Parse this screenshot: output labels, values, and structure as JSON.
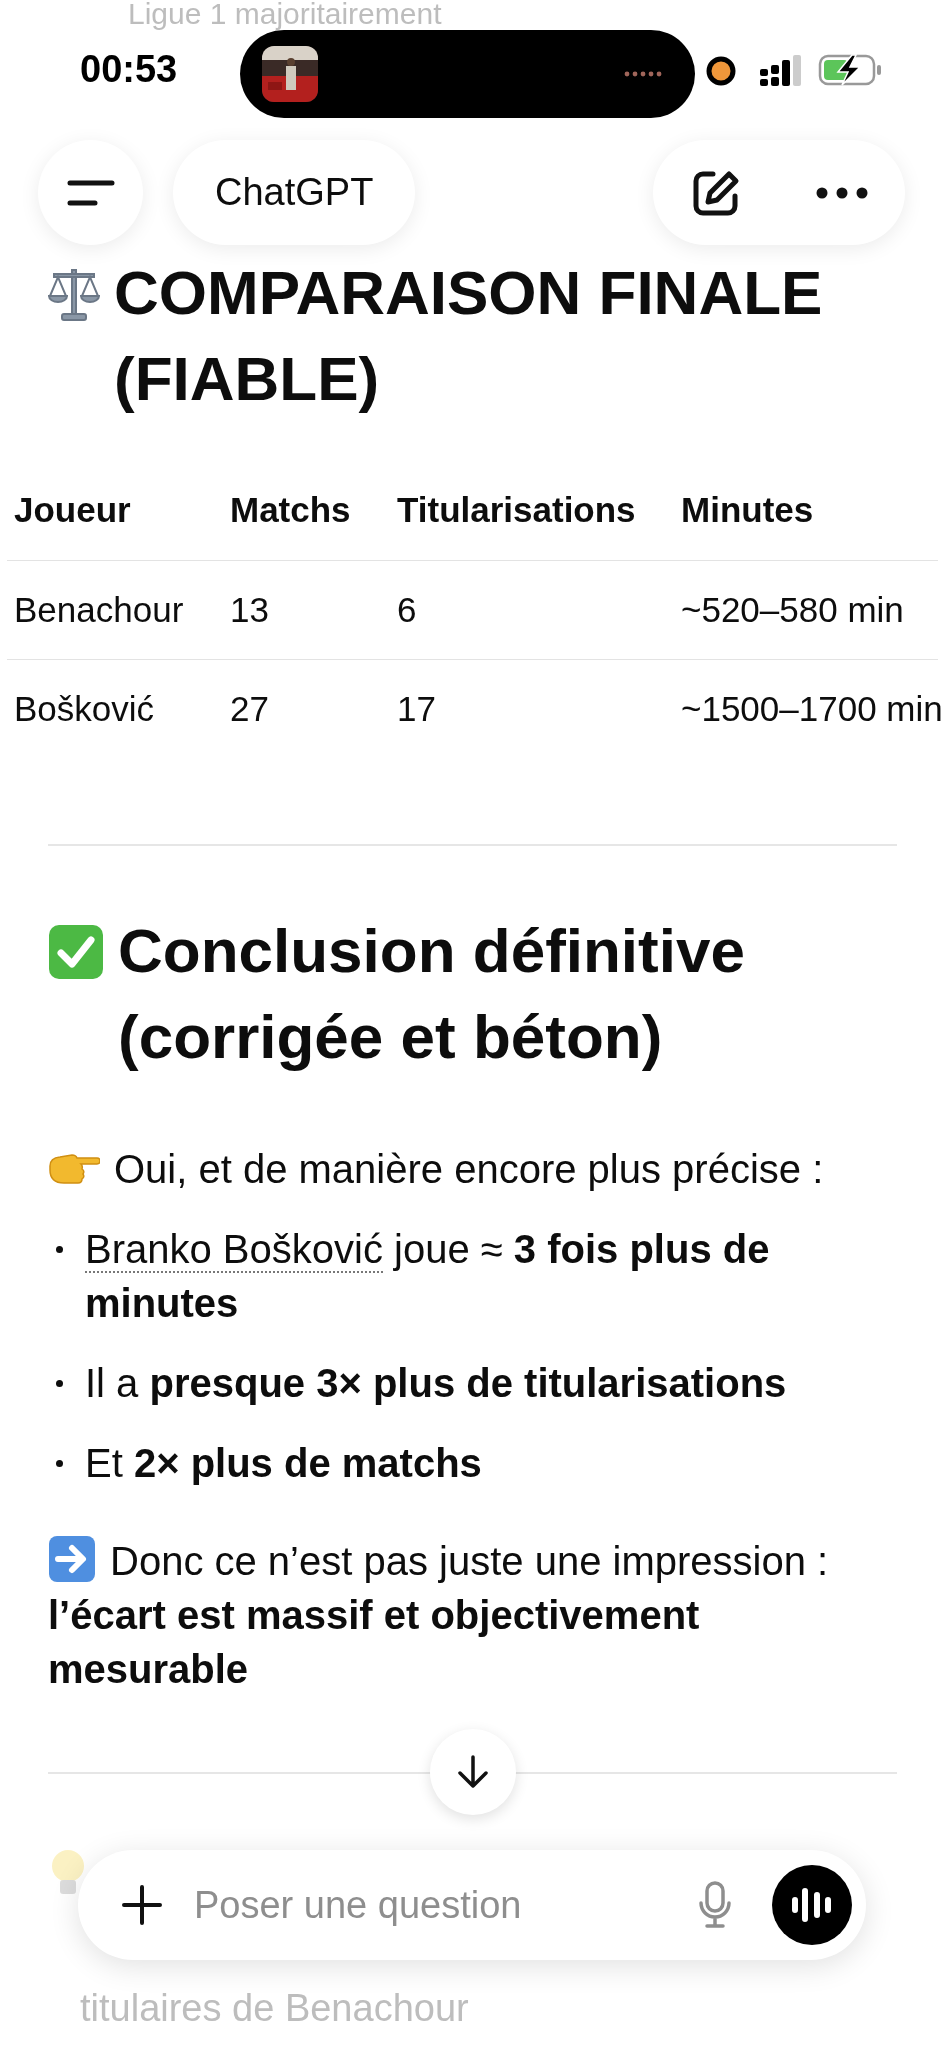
{
  "background_text": {
    "top_line": "Ligue 1 majoritairement",
    "bottom_line": "titulaires de Benachour"
  },
  "status_bar": {
    "time": "00:53"
  },
  "header": {
    "title": "ChatGPT"
  },
  "comparison": {
    "heading": "COMPARAISON FINALE (FIABLE)",
    "table": {
      "columns": [
        "Joueur",
        "Matchs",
        "Titularisations",
        "Minutes"
      ],
      "rows": [
        [
          "Benachour",
          "13",
          "6",
          "~520–580 min"
        ],
        [
          "Bošković",
          "27",
          "17",
          "~1500–1700 min"
        ]
      ]
    }
  },
  "conclusion": {
    "heading": "Conclusion définitive (corrigée et béton)",
    "intro": "Oui, et de manière encore plus précise :",
    "bullets": [
      {
        "link": "Branko Bošković",
        "text": " joue ≈ **3 fois plus de minutes**"
      },
      {
        "text": "Il a **presque 3× plus de titularisations**"
      },
      {
        "text": "Et **2× plus de matchs**"
      }
    ],
    "summary": "Donc ce n’est pas juste une impression : **l’écart est massif et objectivement mesurable**"
  },
  "composer": {
    "placeholder": "Poser une question"
  }
}
